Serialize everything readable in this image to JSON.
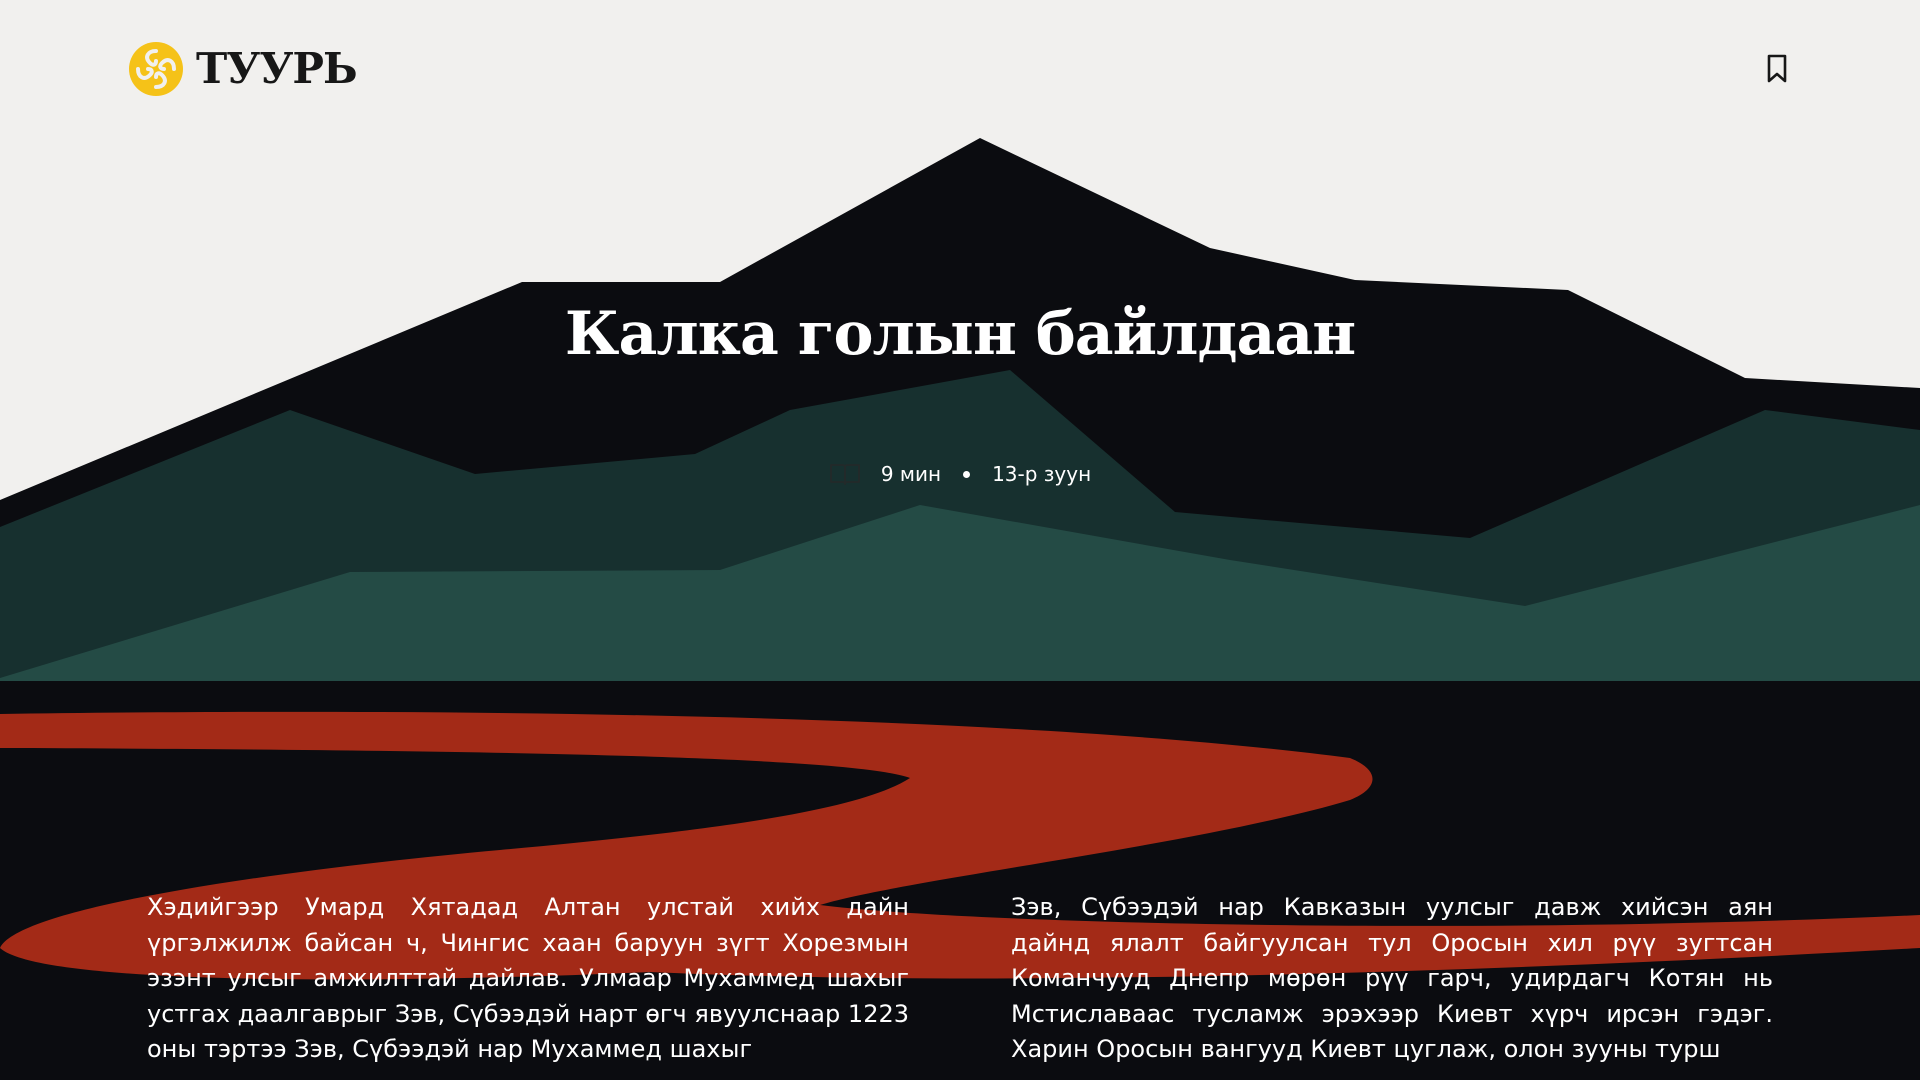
{
  "brand": {
    "name": "ТУУРЬ",
    "logo_icon": "sun-swirl-logo-icon",
    "logo_color": "#f5c218"
  },
  "header": {
    "bookmark_icon": "bookmark-icon"
  },
  "article": {
    "title": "Калка голын байлдаан",
    "reading_icon": "open-book-icon",
    "reading_time": "9 мин",
    "era": "13-р зуун",
    "paragraph_left": "Хэдийгээр Умард Хятадад Алтан улстай хийх дайн үргэлжилж байсан ч, Чингис хаан баруун зүгт Хорезмын эзэнт улсыг амжилттай дайлав. Улмаар Мухаммед шахыг устгах даалгаврыг Зэв, Сүбээдэй нарт өгч явуулснаар 1223 оны тэртээ Зэв, Сүбээдэй нар Мухаммед шахыг",
    "paragraph_right": "Зэв, Сүбээдэй нар Кавказын уулсыг давж хийсэн аян дайнд ялалт байгуулсан тул Оросын хил рүү зугтсан Команчууд Днепр мөрөн рүү гарч, удирдагч Котян нь Мстиславаас тусламж эрэхээр Киевт хүрч ирсэн гэдэг. Харин Оросын вангууд Киевт цуглаж, олон зууны турш"
  },
  "palette": {
    "background": "#f1f0ee",
    "mountain_dark": "#0b0c10",
    "mountain_teal": "#17302f",
    "mountain_green": "#244b45",
    "river_red": "#a32a17",
    "text": "#ffffff"
  }
}
